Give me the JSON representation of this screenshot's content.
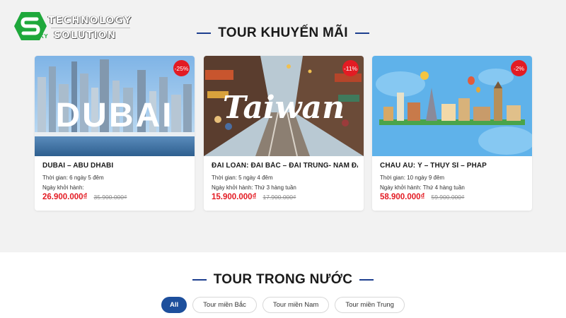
{
  "logo": {
    "line1": "TECHNOLOGY",
    "line2": "SOLUTION",
    "mark_text": "KY",
    "brand_color": "#1ea83b"
  },
  "promo_section": {
    "title": "TOUR KHUYẾN MÃI",
    "tours": [
      {
        "image_text": "DUBAI",
        "discount": "-25%",
        "name": "DUBAI – ABU DHABI",
        "duration": "Thời gian: 6 ngày 5 đêm",
        "departure": "Ngày khởi hành:",
        "price": "26.900.000₫",
        "old_price": "35.900.000₫"
      },
      {
        "image_text": "Taiwan",
        "discount": "-11%",
        "name": "ĐÀI LOAN: ĐÀI BẮC – ĐÀI TRUNG- NAM ĐẦU –",
        "duration": "Thời gian: 5 ngày 4 đêm",
        "departure": "Ngày khởi hành: Thứ 3 hàng tuần",
        "price": "15.900.000₫",
        "old_price": "17.900.000₫"
      },
      {
        "image_text": "",
        "discount": "-2%",
        "name": "CHÂU ÂU: Ý – THỤY SĨ – PHÁP",
        "duration": "Thời gian: 10 ngày 9 đêm",
        "departure": "Ngày khởi hành: Thứ 4 hàng tuần",
        "price": "58.900.000₫",
        "old_price": "59.900.000₫"
      }
    ]
  },
  "domestic_section": {
    "title": "TOUR TRONG NƯỚC",
    "filters": [
      "All",
      "Tour miền Bắc",
      "Tour miền Nam",
      "Tour miền Trung"
    ],
    "active_filter": "All"
  },
  "colors": {
    "accent": "#1d4f9c",
    "title_dash": "#1d3f8f",
    "sale": "#e31b23",
    "section_bg": "#f2f2f2"
  }
}
